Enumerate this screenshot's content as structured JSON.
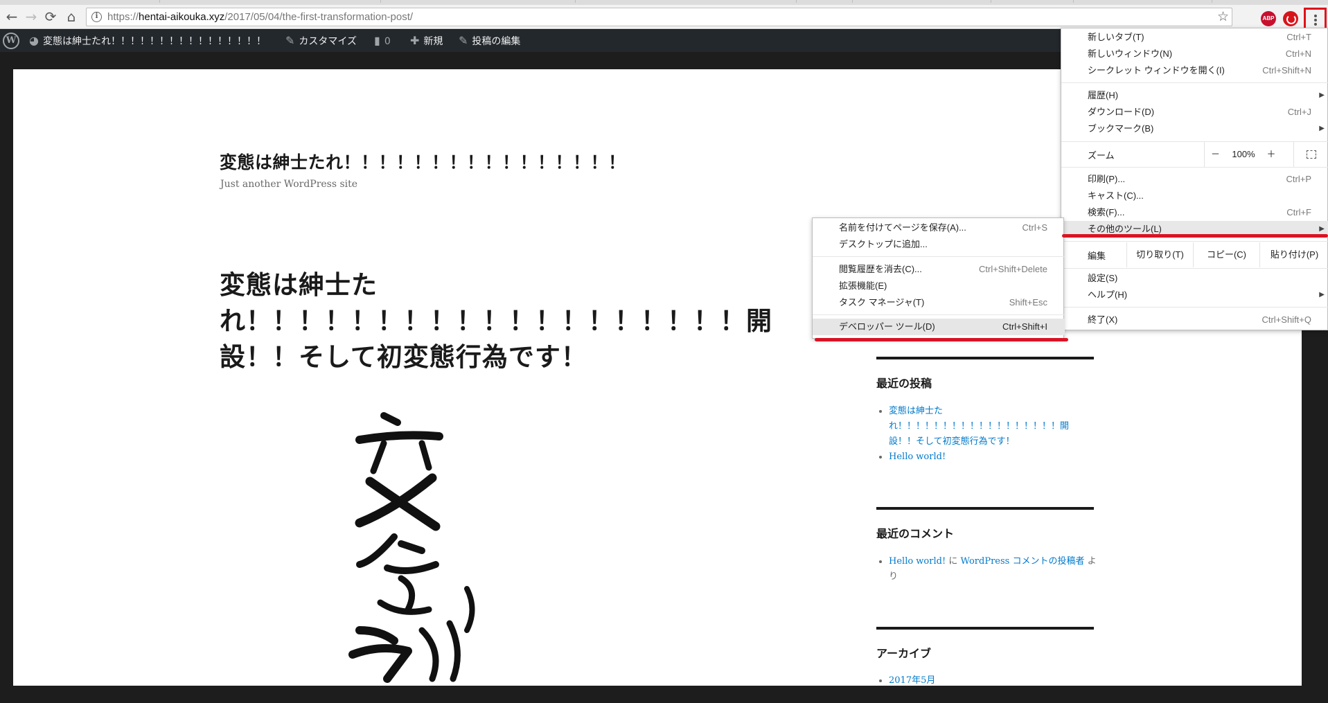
{
  "browser": {
    "url_prefix": "https://",
    "url_host": "hentai-aikouka.xyz",
    "url_path": "/2017/05/04/the-first-transformation-post/",
    "back_icon": "←",
    "forward_icon": "→",
    "reload_icon": "⟳",
    "home_icon": "⌂",
    "info_icon": "i",
    "star_icon": "☆",
    "abp_label": "ABP"
  },
  "adminbar": {
    "wp_logo": "W",
    "site_icon": "◕",
    "site_name": "変態は紳士たれ！！！！！！！！！！！！！！！！",
    "customize_icon": "✎",
    "customize": "カスタマイズ",
    "comments_icon": "▮",
    "comments_count": "0",
    "new_icon": "✚",
    "new": "新規",
    "edit_icon": "✎",
    "edit_post": "投稿の編集"
  },
  "site": {
    "title": "変態は紳士たれ！！！！！！！！！！！！！！！！",
    "description": "Just another WordPress site"
  },
  "post": {
    "title": "変態は紳士たれ！！！！！！！！！！！！！！！！！！！開設！！そして初変態行為です！"
  },
  "sidebar": {
    "recent_posts_title": "最近の投稿",
    "recent_posts": [
      "変態は紳士たれ！！！！！！！！！！！！！！！！！！開設！！そして初変態行為です！",
      "Hello world!"
    ],
    "recent_comments_title": "最近のコメント",
    "comment_post": "Hello world!",
    "comment_on": "に",
    "comment_author": "WordPress コメントの投稿者",
    "comment_from": "より",
    "archive_title": "アーカイブ",
    "archives": [
      "2017年5月"
    ]
  },
  "main_menu": {
    "new_tab": "新しいタブ(T)",
    "new_tab_sc": "Ctrl+T",
    "new_window": "新しいウィンドウ(N)",
    "new_window_sc": "Ctrl+N",
    "incognito": "シークレット ウィンドウを開く(I)",
    "incognito_sc": "Ctrl+Shift+N",
    "history": "履歴(H)",
    "downloads": "ダウンロード(D)",
    "downloads_sc": "Ctrl+J",
    "bookmarks": "ブックマーク(B)",
    "zoom": "ズーム",
    "zoom_minus": "－",
    "zoom_value": "100%",
    "zoom_plus": "＋",
    "print": "印刷(P)...",
    "print_sc": "Ctrl+P",
    "cast": "キャスト(C)...",
    "find": "検索(F)...",
    "find_sc": "Ctrl+F",
    "more_tools": "その他のツール(L)",
    "edit": "編集",
    "cut": "切り取り(T)",
    "copy": "コピー(C)",
    "paste": "貼り付け(P)",
    "settings": "設定(S)",
    "help": "ヘルプ(H)",
    "exit": "終了(X)",
    "exit_sc": "Ctrl+Shift+Q",
    "arrow": "▶"
  },
  "sub_menu": {
    "save_page": "名前を付けてページを保存(A)...",
    "save_page_sc": "Ctrl+S",
    "add_desktop": "デスクトップに追加...",
    "clear_data": "閲覧履歴を消去(C)...",
    "clear_data_sc": "Ctrl+Shift+Delete",
    "extensions": "拡張機能(E)",
    "task_manager": "タスク マネージャ(T)",
    "task_manager_sc": "Shift+Esc",
    "devtools": "デベロッパー ツール(D)",
    "devtools_sc": "Ctrl+Shift+I"
  },
  "colors": {
    "annotation_red": "#d91424",
    "link_blue": "#007acc",
    "adminbar_bg": "#23282d"
  }
}
